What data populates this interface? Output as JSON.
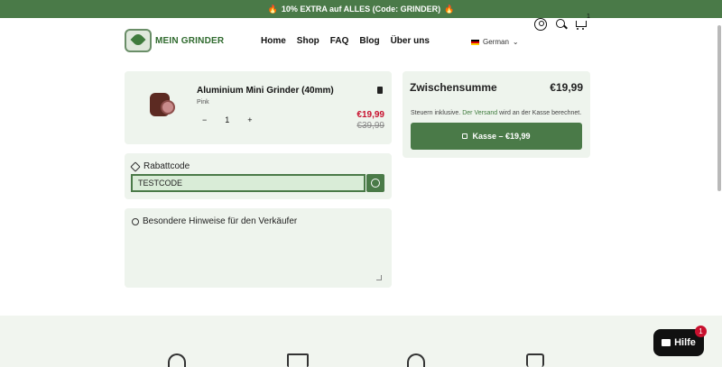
{
  "announcement": {
    "text": "10% EXTRA auf ALLES (Code: GRINDER)",
    "icon": "fire-icon"
  },
  "brand": {
    "name": "MEIN GRINDER",
    "color": "#4a7a48"
  },
  "nav": {
    "items": [
      "Home",
      "Shop",
      "FAQ",
      "Blog",
      "Über uns"
    ]
  },
  "header": {
    "language": "German",
    "cart_count": "1"
  },
  "cart_item": {
    "title": "Aluminium Mini Grinder (40mm)",
    "variant": "Pink",
    "quantity": "1",
    "qty_minus": "−",
    "qty_plus": "+",
    "price_sale": "€19,99",
    "price_original": "€39,99"
  },
  "discount": {
    "label": "Rabattcode",
    "value": "TESTCODE"
  },
  "note": {
    "label": "Besondere Hinweise für den Verkäufer"
  },
  "summary": {
    "subtotal_label": "Zwischensumme",
    "subtotal_value": "€19,99",
    "tax_prefix": "Steuern inklusive.",
    "tax_link": "Der Versand",
    "tax_suffix": "wird an der Kasse berechnet.",
    "checkout_label": "Kasse – €19,99"
  },
  "help_widget": {
    "label": "Hilfe",
    "badge": "1"
  },
  "colors": {
    "accent": "#4a7a48",
    "sale": "#c8102e",
    "panel": "#eef4ed"
  }
}
